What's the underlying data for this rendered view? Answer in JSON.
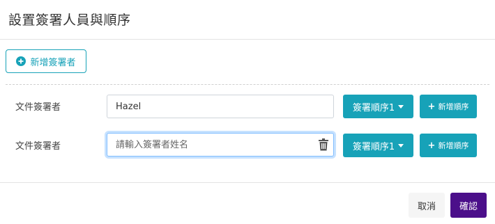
{
  "modal": {
    "title": "設置簽署人員與順序"
  },
  "add_signer_button": {
    "label": "新增簽署者",
    "icon": "plus-circle-icon"
  },
  "signers": [
    {
      "label": "文件簽署者",
      "value": "Hazel",
      "placeholder": "",
      "order_label": "簽署順序1",
      "add_order_label": "新增順序"
    },
    {
      "label": "文件簽署者",
      "value": "",
      "placeholder": "請輸入簽署者姓名",
      "order_label": "簽署順序1",
      "add_order_label": "新增順序",
      "focused": true,
      "icon": "trash-icon"
    }
  ],
  "footer": {
    "cancel_label": "取消",
    "confirm_label": "確認"
  },
  "colors": {
    "accent": "#17a2b8",
    "confirm": "#4b0f8a",
    "focus_ring": "#80bdff"
  }
}
